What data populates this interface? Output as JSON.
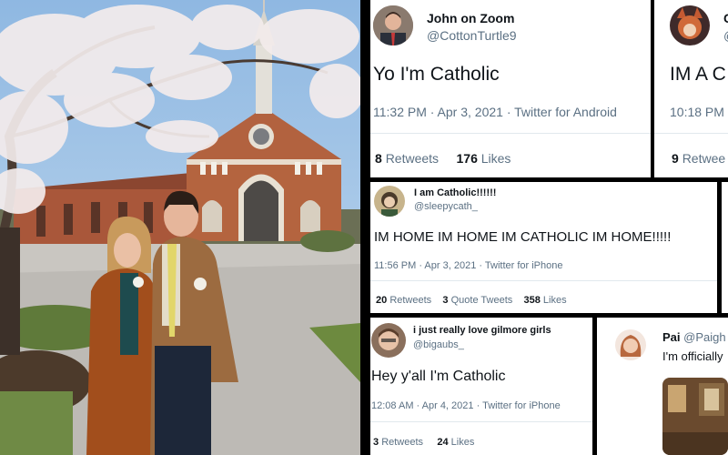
{
  "tweets": [
    {
      "name": "John on Zoom",
      "handle": "@CottonTurtle9",
      "text": "Yo I'm Catholic",
      "meta": "11:32 PM · Apr 3, 2021 · Twitter for Android",
      "stats": [
        {
          "value": "8",
          "label": "Retweets"
        },
        {
          "value": "176",
          "label": "Likes"
        }
      ]
    },
    {
      "name": "C",
      "handle": "@",
      "text": "IM A C",
      "meta": "10:18 PM",
      "stats": [
        {
          "value": "9",
          "label": "Retwee"
        }
      ]
    },
    {
      "name": "I am Catholic!!!!!!",
      "handle": "@sleepycath_",
      "text": "IM HOME IM HOME IM CATHOLIC IM HOME!!!!!",
      "meta": "11:56 PM · Apr 3, 2021 · Twitter for iPhone",
      "stats": [
        {
          "value": "20",
          "label": "Retweets"
        },
        {
          "value": "3",
          "label": "Quote Tweets"
        },
        {
          "value": "358",
          "label": "Likes"
        }
      ]
    },
    {
      "name": "i just really love gilmore girls",
      "handle": "@bigaubs_",
      "text": "Hey y'all I'm Catholic",
      "meta": "12:08 AM · Apr 4, 2021 · Twitter for iPhone",
      "stats": [
        {
          "value": "3",
          "label": "Retweets"
        },
        {
          "value": "24",
          "label": "Likes"
        }
      ]
    },
    {
      "name": "Pai",
      "handle": "@Paigh",
      "text": "I'm officially"
    }
  ],
  "colors": {
    "sky": "#a7c6e4",
    "brick": "#a45a3c",
    "twitter_gray": "#5b7083",
    "divider": "#e1e8ed"
  }
}
